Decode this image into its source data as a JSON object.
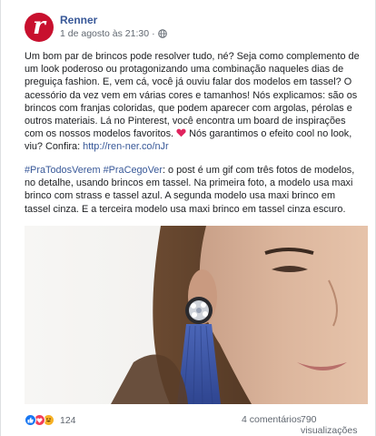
{
  "post": {
    "page_name": "Renner",
    "avatar_letter": "r",
    "timestamp": "1 de agosto às 21:30",
    "separator": "·",
    "body_1_pre": "Um bom par de brincos pode resolver tudo, né? Seja como complemento de um look poderoso ou protagonizando uma combinação naqueles dias de preguiça fashion. E, vem cá, você já ouviu falar dos modelos em tassel? O acessório da vez vem em várias cores e tamanhos! Nós explicamos: são os brincos com franjas coloridas, que podem aparecer com argolas, pérolas e outros materiais. Lá no Pinterest, você encontra um board de inspirações com os nossos modelos favoritos. ",
    "body_1_post": " Nós garantimos o efeito cool no look, viu? Confira: ",
    "body_1_link": "http://ren-ner.co/nJr",
    "hashtag_1": "#PraTodosVerem",
    "hashtag_2": "#PraCegoVer",
    "body_2": ": o post é um gif com três fotos de modelos, no detalhe, usando brincos em tassel. Na primeira foto, a modelo usa maxi brinco com strass e tassel azul. A segunda modelo usa maxi brinco em tassel cinza. E a terceira modelo usa maxi brinco em tassel cinza escuro."
  },
  "footer": {
    "reaction_count": "124",
    "comments": "4 comentários",
    "views": "790 visualizações"
  },
  "colors": {
    "link": "#385898",
    "brand": "#c8102e",
    "like": "#1877f2",
    "love": "#f33e58",
    "haha": "#f7b125",
    "tassel": "#3b55a8"
  },
  "icons": [
    "globe-icon",
    "heart-icon",
    "like-reaction-icon",
    "love-reaction-icon",
    "haha-reaction-icon"
  ]
}
